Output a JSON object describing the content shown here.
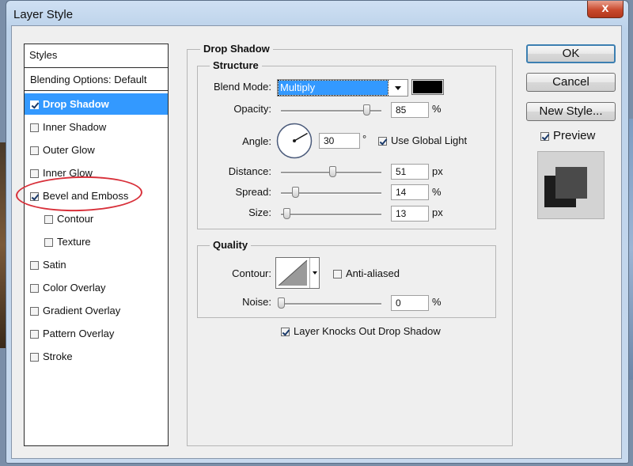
{
  "window": {
    "title": "Layer Style",
    "close_label": "x"
  },
  "styles_list": {
    "header": "Styles",
    "items": [
      {
        "label": "Blending Options: Default",
        "checkbox": false,
        "checked": false,
        "selected": false
      },
      {
        "label": "Drop Shadow",
        "checkbox": true,
        "checked": true,
        "selected": true
      },
      {
        "label": "Inner Shadow",
        "checkbox": true,
        "checked": false,
        "selected": false
      },
      {
        "label": "Outer Glow",
        "checkbox": true,
        "checked": false,
        "selected": false
      },
      {
        "label": "Inner Glow",
        "checkbox": true,
        "checked": false,
        "selected": false
      },
      {
        "label": "Bevel and Emboss",
        "checkbox": true,
        "checked": true,
        "selected": false
      },
      {
        "label": "Contour",
        "checkbox": true,
        "checked": false,
        "selected": false,
        "indent": true
      },
      {
        "label": "Texture",
        "checkbox": true,
        "checked": false,
        "selected": false,
        "indent": true
      },
      {
        "label": "Satin",
        "checkbox": true,
        "checked": false,
        "selected": false
      },
      {
        "label": "Color Overlay",
        "checkbox": true,
        "checked": false,
        "selected": false
      },
      {
        "label": "Gradient Overlay",
        "checkbox": true,
        "checked": false,
        "selected": false
      },
      {
        "label": "Pattern Overlay",
        "checkbox": true,
        "checked": false,
        "selected": false
      },
      {
        "label": "Stroke",
        "checkbox": true,
        "checked": false,
        "selected": false
      }
    ]
  },
  "drop_shadow": {
    "title": "Drop Shadow",
    "structure": {
      "title": "Structure",
      "blend_mode_label": "Blend Mode:",
      "blend_mode_value": "Multiply",
      "shadow_color": "#000000",
      "opacity": {
        "label": "Opacity:",
        "value": "85",
        "unit": "%",
        "fraction": 0.85
      },
      "angle": {
        "label": "Angle:",
        "value": "30",
        "unit": "°",
        "degrees": 30
      },
      "use_global_light": {
        "label": "Use Global Light",
        "checked": true
      },
      "distance": {
        "label": "Distance:",
        "value": "51",
        "unit": "px",
        "fraction": 0.51
      },
      "spread": {
        "label": "Spread:",
        "value": "14",
        "unit": "%",
        "fraction": 0.14
      },
      "size": {
        "label": "Size:",
        "value": "13",
        "unit": "px",
        "fraction": 0.0528
      }
    },
    "quality": {
      "title": "Quality",
      "contour_label": "Contour:",
      "anti_aliased": {
        "label": "Anti-aliased",
        "checked": false
      },
      "noise": {
        "label": "Noise:",
        "value": "0",
        "unit": "%",
        "fraction": 0
      }
    },
    "knocks_out": {
      "label": "Layer Knocks Out Drop Shadow",
      "checked": true
    }
  },
  "buttons": {
    "ok": "OK",
    "cancel": "Cancel",
    "new_style": "New Style..."
  },
  "preview": {
    "label": "Preview",
    "checked": true
  },
  "colors": {
    "selection": "#3399ff",
    "annotation": "#d8303a",
    "title_bar": "#bcd2ea"
  }
}
